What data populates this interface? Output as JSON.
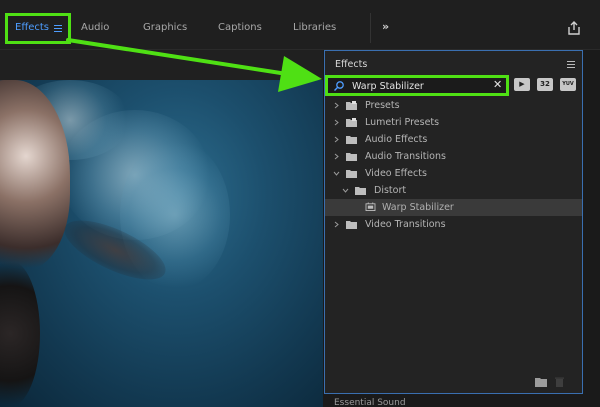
{
  "workspaces": {
    "tabs": [
      {
        "label": "Effects"
      },
      {
        "label": "Audio"
      },
      {
        "label": "Graphics"
      },
      {
        "label": "Captions"
      },
      {
        "label": "Libraries"
      }
    ],
    "more_label": "»"
  },
  "effects_panel": {
    "title": "Effects",
    "search": {
      "value": "Warp Stabilizer",
      "clear_label": "✕"
    },
    "filter_buttons": [
      {
        "label": "▶"
      },
      {
        "label": "32"
      },
      {
        "label": "YUV"
      }
    ],
    "tree": [
      {
        "label": "Presets",
        "expanded": false
      },
      {
        "label": "Lumetri Presets",
        "expanded": false
      },
      {
        "label": "Audio Effects",
        "expanded": false
      },
      {
        "label": "Audio Transitions",
        "expanded": false
      },
      {
        "label": "Video Effects",
        "expanded": true
      },
      {
        "label": "Distort",
        "expanded": true
      },
      {
        "label": "Warp Stabilizer",
        "selected": true
      },
      {
        "label": "Video Transitions",
        "expanded": false
      }
    ]
  },
  "bottom_panel_label": "Essential Sound",
  "colors": {
    "accent_blue": "#4e9dff",
    "highlight_green": "#4fe014",
    "panel_border": "#3a6fb0"
  }
}
